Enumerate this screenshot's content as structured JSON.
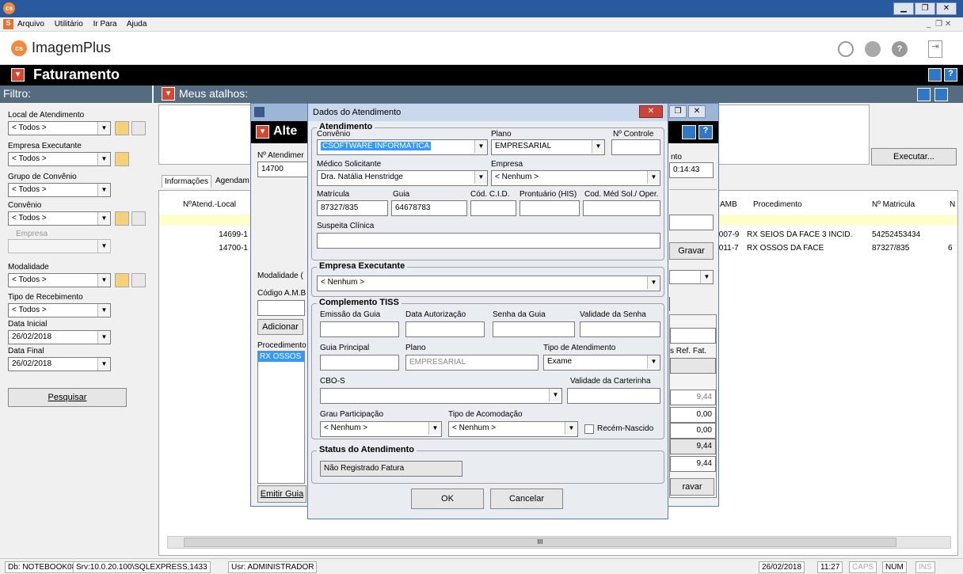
{
  "menu": {
    "items": [
      "Arquivo",
      "Utilitário",
      "Ir Para",
      "Ajuda"
    ]
  },
  "brand": {
    "name": "ImagemPlus"
  },
  "header": {
    "title": "Faturamento"
  },
  "filter": {
    "title": "Filtro:",
    "local_label": "Local de Atendimento",
    "local_value": "< Todos >",
    "empresa_exec_label": "Empresa Executante",
    "empresa_exec_value": "< Todos >",
    "grupo_label": "Grupo de Convênio",
    "grupo_value": "< Todos >",
    "convenio_label": "Convênio",
    "convenio_value": "< Todos >",
    "empresa_label": "Empresa",
    "modalidade_label": "Modalidade",
    "modalidade_value": "< Todos >",
    "tiporec_label": "Tipo de Recebimento",
    "tiporec_value": "< Todos >",
    "data_ini_label": "Data Inicial",
    "data_ini_value": "26/02/2018",
    "data_fim_label": "Data Final",
    "data_fim_value": "26/02/2018",
    "pesquisar": "Pesquisar"
  },
  "atalhos": {
    "title": "Meus atalhos:",
    "executar": "Executar..."
  },
  "tabs": {
    "info": "Informações",
    "agend": "Agendam"
  },
  "grid": {
    "col1": "NºAtend.-Local",
    "col_amb": "AMB",
    "col_proc": "Procedimento",
    "col_mat": "Nº Matricula",
    "col_n": "N",
    "rows": [
      {
        "atend": "14699-1",
        "amb": ".007-9",
        "proc": "RX SEIOS DA FACE 3 INCID.",
        "mat": "54252453434",
        "extra": ""
      },
      {
        "atend": "14700-1",
        "amb": ".011-7",
        "proc": "RX OSSOS DA FACE",
        "mat": "87327/835",
        "extra": "6"
      }
    ]
  },
  "alt": {
    "title": "Alte",
    "atend_label": "Nº Atendimer",
    "atend_value": "14700",
    "modalidade": "Modalidade (",
    "codigo": "Código A.M.B",
    "adicionar": "Adicionar",
    "procedimento": "Procedimento",
    "proc_sel": "RX OSSOS",
    "emitir": "Emitir Guia",
    "time_frag": "nto",
    "time_val": "0:14:43",
    "gravar": "Gravar",
    "gravar2": "ravar",
    "refat": "s Ref. Fat.",
    "num1": "9,44",
    "num2": "0,00",
    "num3": "0,00",
    "num4": "9,44",
    "num5": "9,44"
  },
  "dialog": {
    "title": "Dados do Atendimento",
    "atend_group": "Atendimento",
    "convenio_label": "Convênio",
    "convenio_value": "CSOFTWARE INFORMÁTICA",
    "plano_label": "Plano",
    "plano_value": "EMPRESARIAL",
    "ncontrole_label": "Nº Controle",
    "ncontrole_value": "",
    "medico_label": "Médico Solicitante",
    "medico_value": "Dra. Natália Henstridge",
    "empresa_label": "Empresa",
    "empresa_value": "< Nenhum >",
    "matricula_label": "Matrícula",
    "matricula_value": "87327/835",
    "guia_label": "Guia",
    "guia_value": "64678783",
    "cid_label": "Cód. C.I.D.",
    "pront_label": "Prontuário (HIS)",
    "codmed_label": "Cod. Méd Sol./ Oper.",
    "suspeita_label": "Suspeita Clínica",
    "emp_exec_group": "Empresa Executante",
    "emp_exec_value": "< Nenhum >",
    "tiss_group": "Complemento TISS",
    "emissao_label": "Emissão da Guia",
    "data_aut_label": "Data Autorização",
    "senha_label": "Senha da Guia",
    "validade_senha_label": "Validade da Senha",
    "guia_principal_label": "Guia Principal",
    "plano2_label": "Plano",
    "plano2_value": "EMPRESARIAL",
    "tipo_atend_label": "Tipo de Atendimento",
    "tipo_atend_value": "Exame",
    "cbo_label": "CBO-S",
    "validade_cart_label": "Validade da Carterinha",
    "grau_label": "Grau Participação",
    "grau_value": "< Nenhum >",
    "acomod_label": "Tipo de Acomodação",
    "acomod_value": "< Nenhum >",
    "recem_label": "Recém-Nascido",
    "status_group": "Status do Atendimento",
    "status_value": "Não Registrado Fatura",
    "ok": "OK",
    "cancelar": "Cancelar"
  },
  "statusbar": {
    "db": "Db: NOTEBOOK08",
    "srv": "Srv:10.0.20.100\\SQLEXPRESS,1433",
    "usr": "Usr: ADMINISTRADOR",
    "date": "26/02/2018",
    "time": "11:27",
    "caps": "CAPS",
    "num": "NUM",
    "ins": "INS"
  }
}
